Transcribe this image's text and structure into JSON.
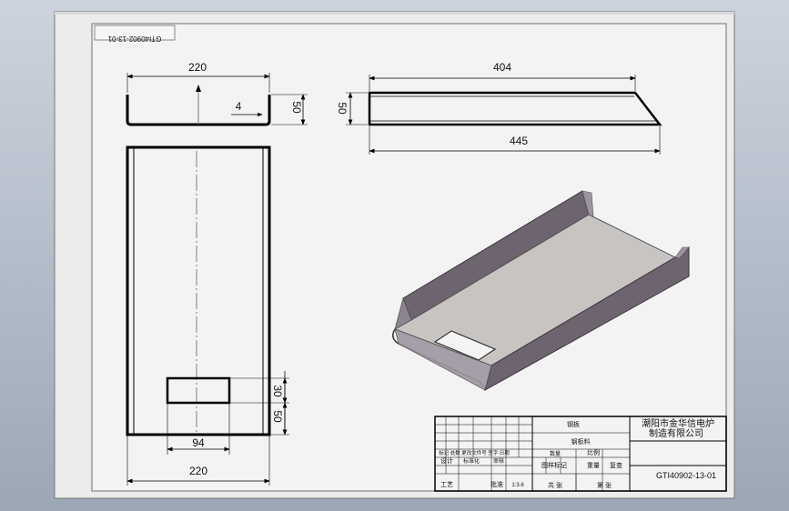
{
  "drawing_number": "GTI40902-13-01",
  "drawing_number_mirrored": "GTI40902-13-01",
  "front_view": {
    "width_dim": "220",
    "inner_dim": "4",
    "height_dim": "50"
  },
  "plan_view": {
    "slot_height_a": "30",
    "slot_height_b": "50",
    "slot_width": "94",
    "overall_width": "220"
  },
  "side_view": {
    "top_length": "404",
    "bottom_length": "445",
    "height": "50"
  },
  "title_block": {
    "company_line1": "潮阳市金华信电炉",
    "company_line2": "制造有限公司",
    "material": "钢板",
    "part_name": "钢板料",
    "label_quantity": "数量",
    "label_scale": "比例",
    "label_drawing_mark": "图样标记",
    "label_weight": "重量",
    "label_approval_row": "标记 处数 更改文件号 签字 日期",
    "label_design": "设计",
    "label_checked": "标准化",
    "label_reviewed": "审核",
    "label_process": "工艺",
    "label_approved": "批准",
    "label_date": "日期",
    "label_standard": "比例",
    "scale_value": "1:3.6",
    "label_sheets_total": "共 张",
    "label_sheet_no": "第 张",
    "label_recheck": "复查"
  },
  "colors": {
    "background": "#b6bfcc",
    "sheet": "#f2f2f2",
    "line": "#000000",
    "iso_top": "#c8c4c1",
    "iso_wall": "#6e6470",
    "iso_edge": "#9c96a0"
  }
}
